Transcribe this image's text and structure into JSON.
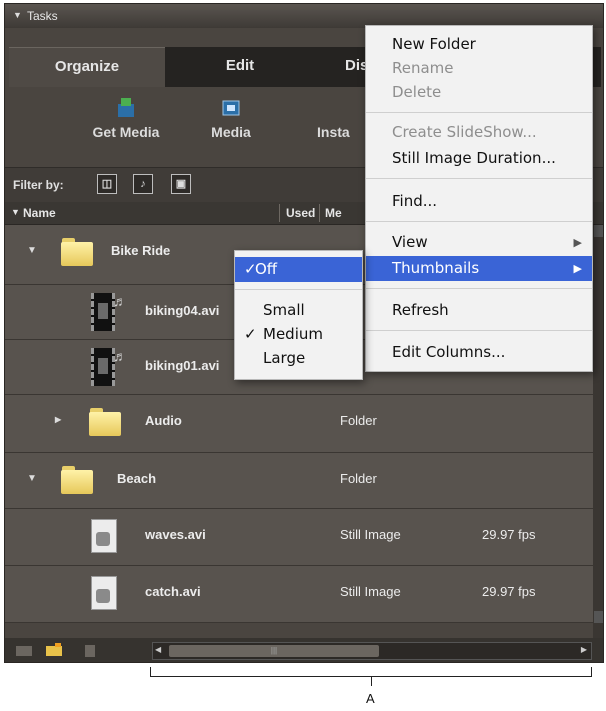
{
  "panel_title": "Tasks",
  "tabs": [
    {
      "label": "Organize",
      "active": true
    },
    {
      "label": "Edit",
      "active": false
    },
    {
      "label": "Dis",
      "active": false
    }
  ],
  "toolbar": {
    "get_media": "Get Media",
    "media": "Media",
    "instant": "Insta"
  },
  "filter": {
    "label": "Filter by:"
  },
  "columns": {
    "name": "Name",
    "used": "Used",
    "media_type": "Me"
  },
  "rows": [
    {
      "name": "Bike Ride",
      "type": "",
      "fps": "",
      "kind": "folder",
      "expanded": true
    },
    {
      "name": "biking04.avi",
      "type": "",
      "fps": "",
      "kind": "video"
    },
    {
      "name": "biking01.avi",
      "type": "",
      "fps": "",
      "kind": "video"
    },
    {
      "name": "Audio",
      "type": "Folder",
      "fps": "",
      "kind": "folder",
      "expanded": false
    },
    {
      "name": "Beach",
      "type": "Folder",
      "fps": "",
      "kind": "folder",
      "expanded": true
    },
    {
      "name": "waves.avi",
      "type": "Still Image",
      "fps": "29.97 fps",
      "kind": "still"
    },
    {
      "name": "catch.avi",
      "type": "Still Image",
      "fps": "29.97 fps",
      "kind": "still"
    }
  ],
  "context_menu": {
    "new_folder": "New Folder",
    "rename": "Rename",
    "delete": "Delete",
    "create_slideshow": "Create SlideShow...",
    "still_duration": "Still Image Duration...",
    "find": "Find...",
    "view": "View",
    "thumbnails": "Thumbnails",
    "refresh": "Refresh",
    "edit_columns": "Edit Columns..."
  },
  "thumbnails_submenu": {
    "off": "Off",
    "small": "Small",
    "medium": "Medium",
    "large": "Large",
    "checked": [
      "Off",
      "Medium"
    ]
  },
  "callout_label": "A",
  "colors": {
    "highlight": "#3a64d6",
    "panel": "#4a4540",
    "row": "#58534e"
  }
}
